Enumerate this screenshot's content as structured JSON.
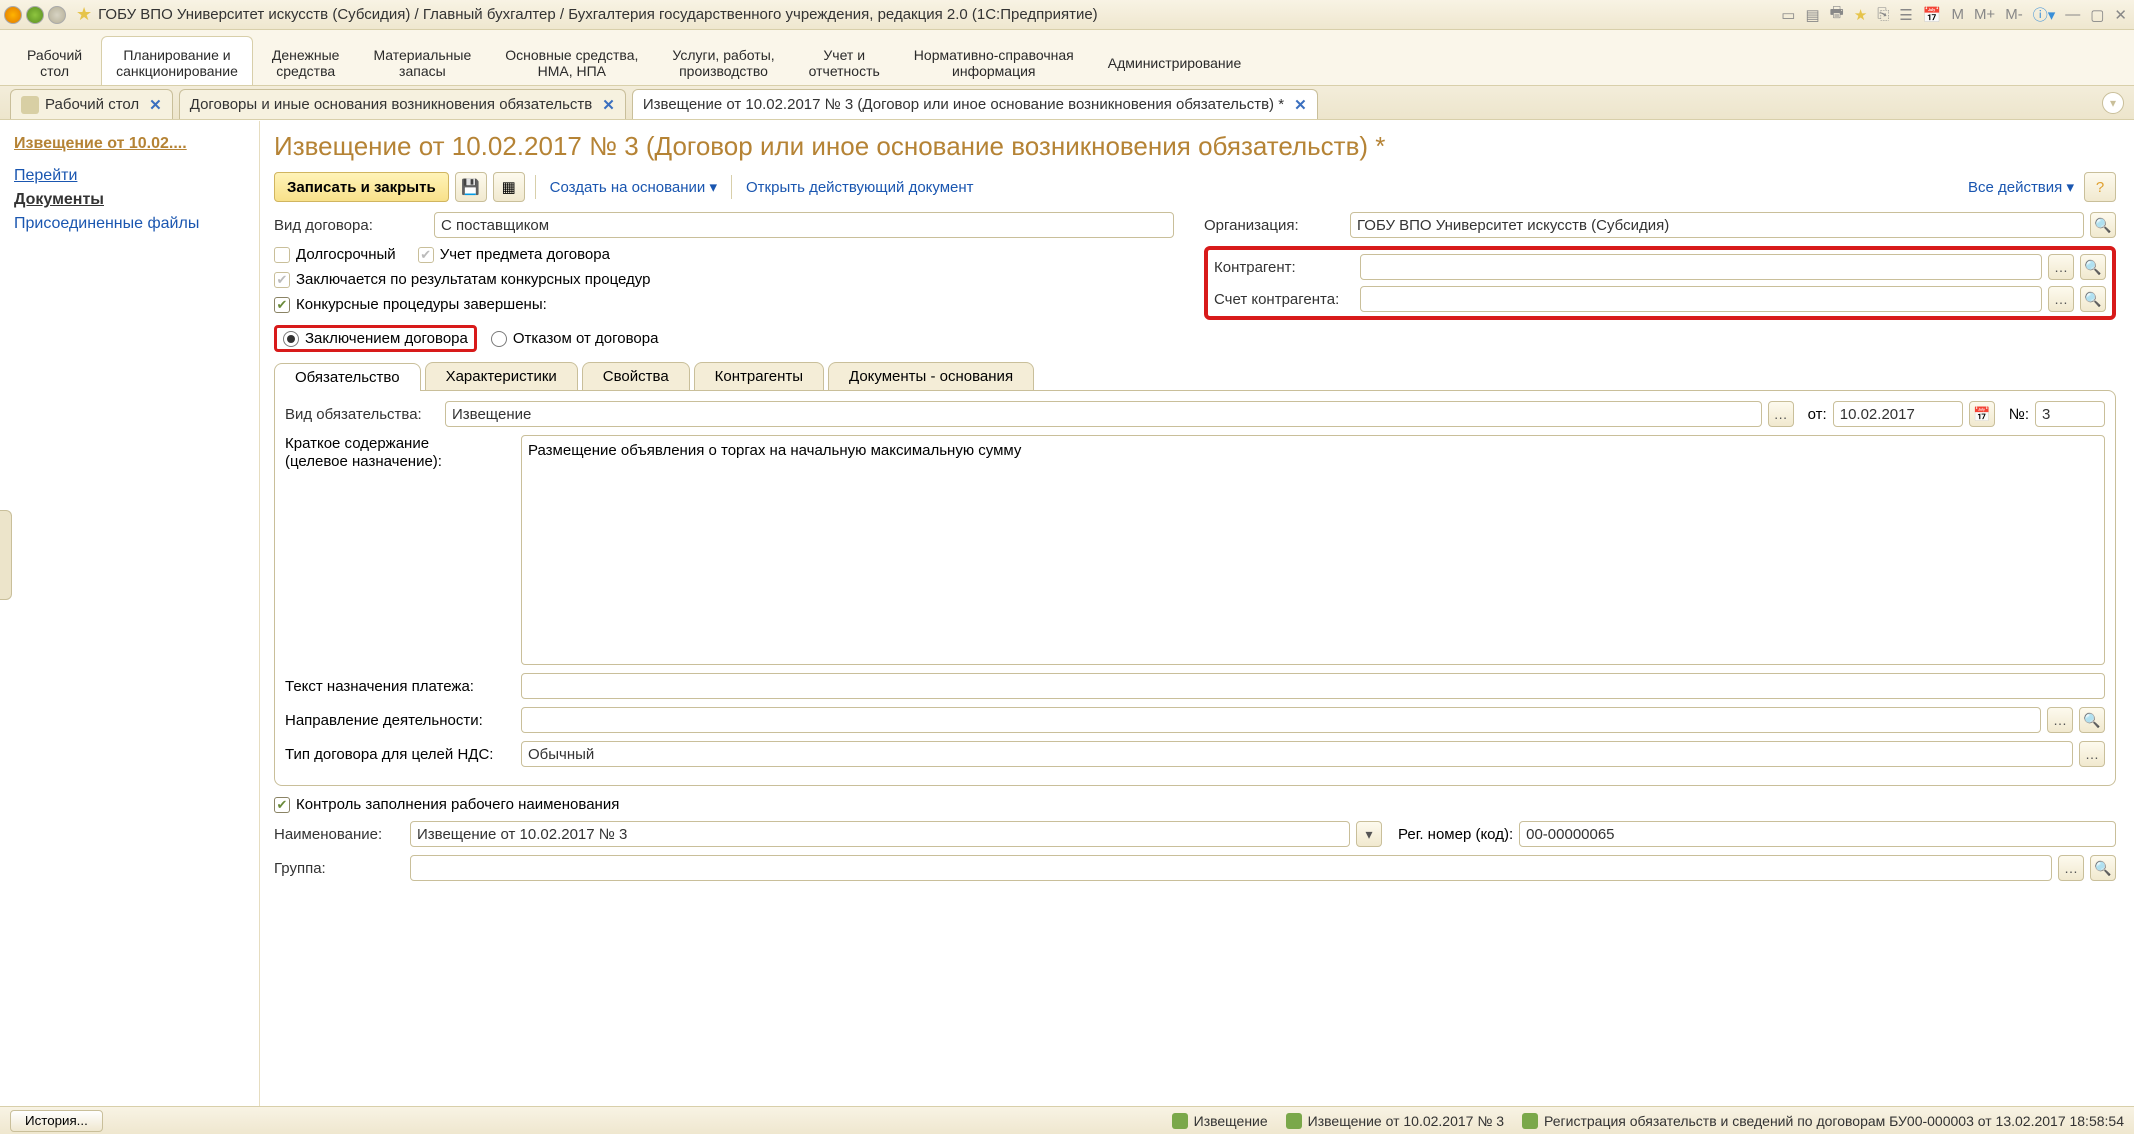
{
  "titlebar": {
    "text": "ГОБУ ВПО Университет искусств (Субсидия) / Главный бухгалтер / Бухгалтерия государственного учреждения, редакция 2.0  (1С:Предприятие)",
    "right_m": "M",
    "right_mp": "M+",
    "right_mm": "M-"
  },
  "sections": {
    "s0a": "Рабочий",
    "s0b": "стол",
    "s1a": "Планирование и",
    "s1b": "санкционирование",
    "s2a": "Денежные",
    "s2b": "средства",
    "s3a": "Материальные",
    "s3b": "запасы",
    "s4a": "Основные средства,",
    "s4b": "НМА, НПА",
    "s5a": "Услуги, работы,",
    "s5b": "производство",
    "s6a": "Учет и",
    "s6b": "отчетность",
    "s7a": "Нормативно-справочная",
    "s7b": "информация",
    "s8a": "Администрирование",
    "s8b": ""
  },
  "tabs": {
    "t0": "Рабочий стол",
    "t1": "Договоры и иные основания возникновения обязательств",
    "t2": "Извещение от 10.02.2017 № 3 (Договор или иное основание возникновения обязательств) *"
  },
  "nav": {
    "title": "Извещение от 10.02....",
    "go": "Перейти",
    "docs": "Документы",
    "files": "Присоединенные файлы"
  },
  "form": {
    "title": "Извещение от 10.02.2017 № 3 (Договор или иное основание возникновения обязательств) *",
    "save_close": "Записать и закрыть",
    "create_based": "Создать на основании",
    "open_actual": "Открыть действующий документ",
    "all_actions": "Все действия",
    "vid_label": "Вид договора:",
    "vid_value": "С поставщиком",
    "org_label": "Организация:",
    "org_value": "ГОБУ ВПО Университет искусств (Субсидия)",
    "kontr_label": "Контрагент:",
    "schet_label": "Счет контрагента:",
    "chk_long": "Долгосрочный",
    "chk_subj": "Учет предмета договора",
    "chk_konk": "Заключается по результатам конкурсных процедур",
    "chk_done": "Конкурсные процедуры завершены:",
    "radio_done": "Заключением договора",
    "radio_refuse": "Отказом от договора"
  },
  "itabs": {
    "t0": "Обязательство",
    "t1": "Характеристики",
    "t2": "Свойства",
    "t3": "Контрагенты",
    "t4": "Документы - основания"
  },
  "pane": {
    "vid_ob_label": "Вид обязательства:",
    "vid_ob_value": "Извещение",
    "ot_label": "от:",
    "ot_value": "10.02.2017",
    "no_label": "№:",
    "no_value": "3",
    "brief_l1": "Краткое содержание",
    "brief_l2": "(целевое назначение):",
    "brief_value": "Размещение объявления о торгах на начальную максимальную сумму",
    "tnp_label": "Текст назначения платежа:",
    "nd_label": "Направление деятельности:",
    "tdn_label": "Тип договора для целей НДС:",
    "tdn_value": "Обычный"
  },
  "below": {
    "chk_ctrl": "Контроль заполнения рабочего наименования",
    "name_label": "Наименование:",
    "name_value": "Извещение от 10.02.2017 № 3",
    "reg_label": "Рег. номер (код):",
    "reg_value": "00-00000065",
    "group_label": "Группа:"
  },
  "status": {
    "history": "История...",
    "s1": "Извещение",
    "s2": "Извещение от 10.02.2017 № 3",
    "s3": "Регистрация обязательств и сведений по договорам БУ00-000003 от 13.02.2017 18:58:54"
  }
}
